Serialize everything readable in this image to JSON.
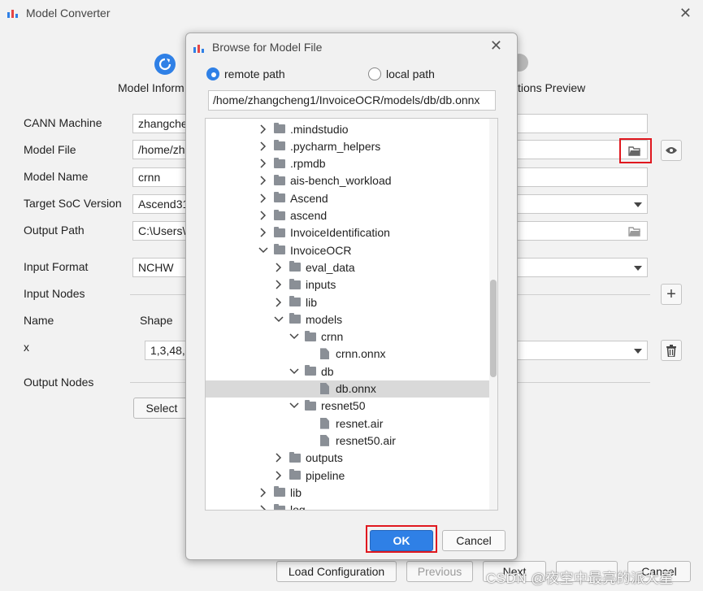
{
  "app": {
    "title": "Model Converter",
    "close": "✕"
  },
  "steps": {
    "first": "Model Inform",
    "last": "tions  Preview"
  },
  "form": {
    "cann_label": "CANN Machine",
    "cann_value": "zhangche",
    "model_file_label": "Model File",
    "model_file_value": "/home/zh",
    "model_name_label": "Model Name",
    "model_name_value": "crnn",
    "soc_label": "Target SoC Version",
    "soc_value": "Ascend31",
    "output_path_label": "Output Path",
    "output_path_value": "C:\\Users\\",
    "input_format_label": "Input Format",
    "input_format_value": "NCHW",
    "input_nodes_label": "Input Nodes",
    "name_col": "Name",
    "shape_col": "Shape",
    "node_name": "x",
    "node_shape": "1,3,48,",
    "output_nodes_label": "Output Nodes",
    "select_label": "Select"
  },
  "bottom": {
    "load": "Load Configuration",
    "previous": "Previous",
    "next": "Next",
    "cancel": "Cancel"
  },
  "dialog": {
    "title": "Browse for Model File",
    "close": "✕",
    "remote": "remote path",
    "local": "local path",
    "path": "/home/zhangcheng1/InvoiceOCR/models/db/db.onnx",
    "ok": "OK",
    "cancel": "Cancel",
    "tree": [
      {
        "label": ".mindstudio",
        "depth": 0,
        "kind": "folder",
        "state": "collapsed"
      },
      {
        "label": ".pycharm_helpers",
        "depth": 0,
        "kind": "folder",
        "state": "collapsed"
      },
      {
        "label": ".rpmdb",
        "depth": 0,
        "kind": "folder",
        "state": "collapsed"
      },
      {
        "label": "ais-bench_workload",
        "depth": 0,
        "kind": "folder",
        "state": "collapsed"
      },
      {
        "label": "Ascend",
        "depth": 0,
        "kind": "folder",
        "state": "collapsed"
      },
      {
        "label": "ascend",
        "depth": 0,
        "kind": "folder",
        "state": "collapsed"
      },
      {
        "label": "InvoiceIdentification",
        "depth": 0,
        "kind": "folder",
        "state": "collapsed"
      },
      {
        "label": "InvoiceOCR",
        "depth": 0,
        "kind": "folder",
        "state": "expanded"
      },
      {
        "label": "eval_data",
        "depth": 1,
        "kind": "folder",
        "state": "collapsed"
      },
      {
        "label": "inputs",
        "depth": 1,
        "kind": "folder",
        "state": "collapsed"
      },
      {
        "label": "lib",
        "depth": 1,
        "kind": "folder",
        "state": "collapsed"
      },
      {
        "label": "models",
        "depth": 1,
        "kind": "folder",
        "state": "expanded"
      },
      {
        "label": "crnn",
        "depth": 2,
        "kind": "folder",
        "state": "expanded"
      },
      {
        "label": "crnn.onnx",
        "depth": 3,
        "kind": "file",
        "state": "none"
      },
      {
        "label": "db",
        "depth": 2,
        "kind": "folder",
        "state": "expanded"
      },
      {
        "label": "db.onnx",
        "depth": 3,
        "kind": "file",
        "state": "selected"
      },
      {
        "label": "resnet50",
        "depth": 2,
        "kind": "folder",
        "state": "expanded"
      },
      {
        "label": "resnet.air",
        "depth": 3,
        "kind": "file",
        "state": "none"
      },
      {
        "label": "resnet50.air",
        "depth": 3,
        "kind": "file",
        "state": "none"
      },
      {
        "label": "outputs",
        "depth": 1,
        "kind": "folder",
        "state": "collapsed"
      },
      {
        "label": "pipeline",
        "depth": 1,
        "kind": "folder",
        "state": "collapsed"
      },
      {
        "label": "lib",
        "depth": 0,
        "kind": "folder",
        "state": "collapsed"
      },
      {
        "label": "log",
        "depth": 0,
        "kind": "folder",
        "state": "collapsed"
      }
    ]
  },
  "watermark": "CSDN @夜空中最亮的派大星",
  "colors": {
    "accent": "#2f80e6",
    "highlight": "#e0181f"
  }
}
